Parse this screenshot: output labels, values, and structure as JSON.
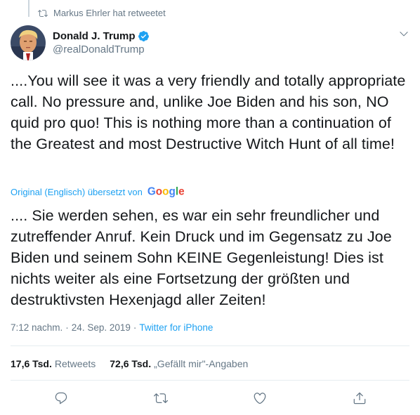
{
  "retweet": {
    "text": "Markus Ehrler hat retweetet",
    "icon": "retweet-icon"
  },
  "author": {
    "display_name": "Donald J. Trump",
    "handle": "@realDonaldTrump",
    "verified_icon": "verified-badge-icon"
  },
  "tweet": {
    "text": "....You will see it was a very friendly and totally appropriate call. No pressure and, unlike Joe Biden and his son, NO quid pro quo! This is nothing more than a continuation of the Greatest and most Destructive Witch Hunt of all time!"
  },
  "translation": {
    "label": "Original (Englisch) übersetzt von",
    "provider": "Google",
    "text": ".... Sie werden sehen, es war ein sehr freundlicher und zutreffender Anruf. Kein Druck und im Gegensatz zu Joe Biden und seinem Sohn KEINE Gegenleistung! Dies ist nichts weiter als eine Fortsetzung der größten und destruktivsten Hexenjagd aller Zeiten!"
  },
  "meta": {
    "time": "7:12 nachm.",
    "separator": "·",
    "date": "24. Sep. 2019",
    "source": "Twitter for iPhone"
  },
  "stats": {
    "retweets_count": "17,6 Tsd.",
    "retweets_label": "Retweets",
    "likes_count": "72,6 Tsd.",
    "likes_label": "„Gefällt mir\"-Angaben"
  },
  "colors": {
    "accent": "#1da1f2",
    "muted": "#657786",
    "text": "#14171a",
    "divider": "#e6ecf0"
  },
  "actions": [
    "reply-icon",
    "retweet-icon",
    "like-icon",
    "share-icon"
  ]
}
